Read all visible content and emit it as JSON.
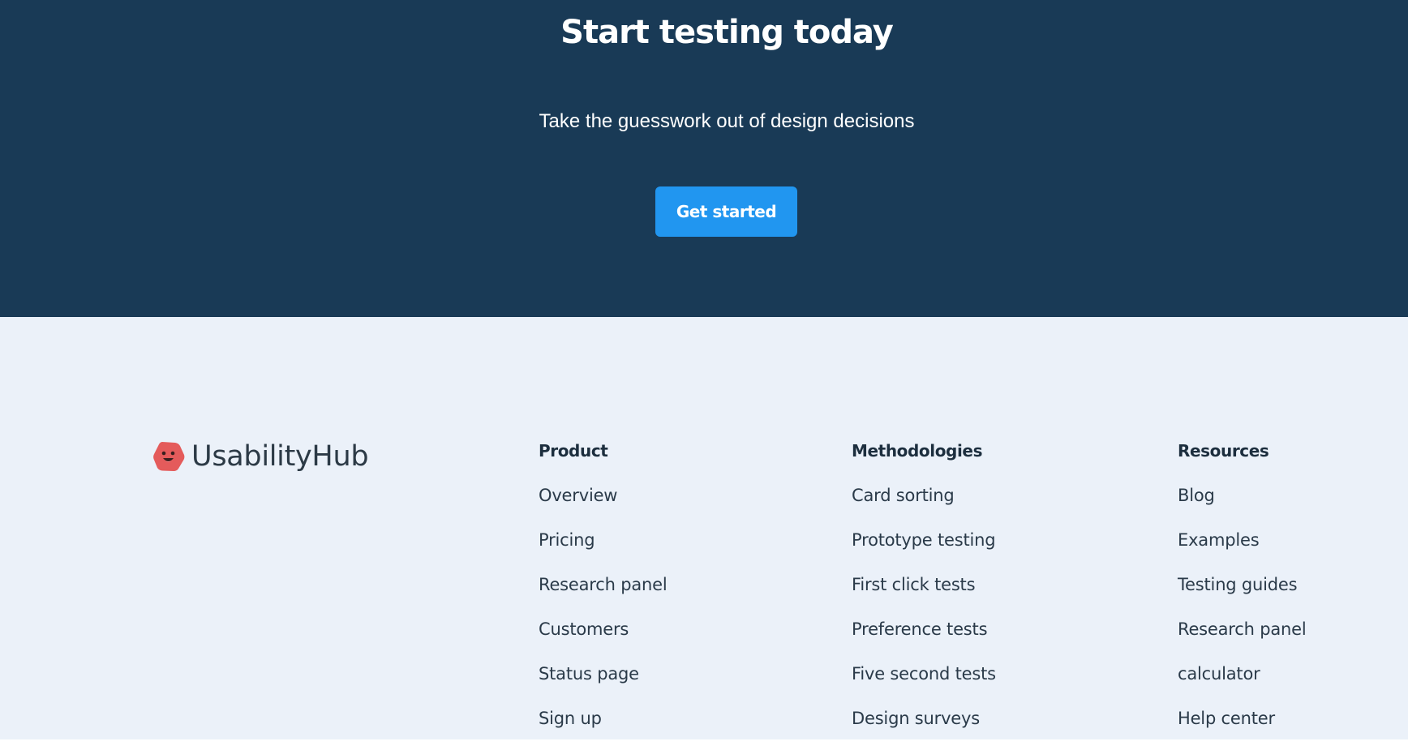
{
  "cta": {
    "title": "Start testing today",
    "subtitle": "Take the guesswork out of design decisions",
    "button_label": "Get started",
    "background": "#193a56",
    "button_color": "#2196f0"
  },
  "footer": {
    "background": "#ebf1f9",
    "logo": {
      "icon": "smiley-hexagon-logo-icon",
      "icon_color": "#e45b5b",
      "text": "UsabilityHub"
    },
    "columns": [
      {
        "heading": "Product",
        "links": [
          "Overview",
          "Pricing",
          "Research panel",
          "Customers",
          "Status page",
          "Sign up"
        ]
      },
      {
        "heading": "Methodologies",
        "links": [
          "Card sorting",
          "Prototype testing",
          "First click tests",
          "Preference tests",
          "Five second tests",
          "Design surveys"
        ]
      },
      {
        "heading": "Resources",
        "links": [
          "Blog",
          "Examples",
          "Testing guides",
          "Research panel",
          "calculator",
          "Help center"
        ]
      }
    ]
  }
}
